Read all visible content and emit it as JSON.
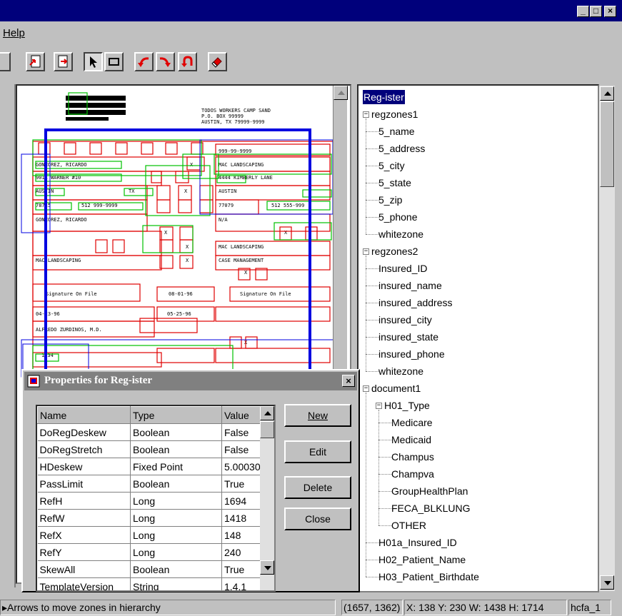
{
  "window": {
    "caption_buttons": [
      "_",
      "□",
      "×"
    ]
  },
  "menubar": {
    "items": [
      {
        "label": "Help"
      }
    ]
  },
  "toolbar": {
    "buttons": [
      "import-icon",
      "export-icon",
      "select-pointer-icon",
      "zone-rectangle-icon",
      "rotate-left-icon",
      "rotate-right-icon",
      "undo-icon",
      "eraser-icon"
    ]
  },
  "document": {
    "header_lines": [
      "TODOS WORKERS CAMP SAND",
      "P.O. BOX 99999",
      "AUSTIN, TX  79999-9999"
    ],
    "fields": [
      "999-99-9999",
      "GONZOREZ, RICARDO",
      "MAC LANDSCAPING",
      "9011 WARNER #10",
      "X",
      "4444 KIMBERLY LANE",
      "AUSTIN",
      "TX",
      "X",
      "AUSTIN",
      "78715",
      "512 999-9999",
      "77079",
      "512 555-999",
      "GONZOREZ, RICARDO",
      "N/A",
      "X",
      "X",
      "X",
      "MAC LANDSCAPING",
      "MAC LANDSCAPING",
      "X",
      "CASE MANAGEMENT",
      "X",
      "Signature On File",
      "08-01-96",
      "Signature On File",
      "04-23-96",
      "05-25-96",
      "ALFREDO ZURDINOS, M.D.",
      "X",
      "1234"
    ]
  },
  "tree": {
    "nodes": [
      {
        "label": "Reg-ister",
        "depth": 0,
        "expander": "",
        "selected": true
      },
      {
        "label": "regzones1",
        "depth": 0,
        "expander": "−"
      },
      {
        "label": "5_name",
        "depth": 1,
        "expander": ""
      },
      {
        "label": "5_address",
        "depth": 1,
        "expander": ""
      },
      {
        "label": "5_city",
        "depth": 1,
        "expander": ""
      },
      {
        "label": "5_state",
        "depth": 1,
        "expander": ""
      },
      {
        "label": "5_zip",
        "depth": 1,
        "expander": ""
      },
      {
        "label": "5_phone",
        "depth": 1,
        "expander": ""
      },
      {
        "label": "whitezone",
        "depth": 1,
        "expander": ""
      },
      {
        "label": "regzones2",
        "depth": 0,
        "expander": "−"
      },
      {
        "label": "Insured_ID",
        "depth": 1,
        "expander": ""
      },
      {
        "label": "insured_name",
        "depth": 1,
        "expander": ""
      },
      {
        "label": "insured_address",
        "depth": 1,
        "expander": ""
      },
      {
        "label": "insured_city",
        "depth": 1,
        "expander": ""
      },
      {
        "label": "insured_state",
        "depth": 1,
        "expander": ""
      },
      {
        "label": "insured_phone",
        "depth": 1,
        "expander": ""
      },
      {
        "label": "whitezone",
        "depth": 1,
        "expander": ""
      },
      {
        "label": "document1",
        "depth": 0,
        "expander": "−"
      },
      {
        "label": "H01_Type",
        "depth": 1,
        "expander": "−"
      },
      {
        "label": "Medicare",
        "depth": 2,
        "expander": ""
      },
      {
        "label": "Medicaid",
        "depth": 2,
        "expander": ""
      },
      {
        "label": "Champus",
        "depth": 2,
        "expander": ""
      },
      {
        "label": "Champva",
        "depth": 2,
        "expander": ""
      },
      {
        "label": "GroupHealthPlan",
        "depth": 2,
        "expander": ""
      },
      {
        "label": "FECA_BLKLUNG",
        "depth": 2,
        "expander": ""
      },
      {
        "label": "OTHER",
        "depth": 2,
        "expander": ""
      },
      {
        "label": "H01a_Insured_ID",
        "depth": 1,
        "expander": ""
      },
      {
        "label": "H02_Patient_Name",
        "depth": 1,
        "expander": ""
      },
      {
        "label": "H03_Patient_Birthdate",
        "depth": 1,
        "expander": ""
      }
    ]
  },
  "dialog": {
    "title": "Properties for Reg-ister",
    "close_label": "×",
    "columns": [
      "Name",
      "Type",
      "Value"
    ],
    "rows": [
      [
        "DoRegDeskew",
        "Boolean",
        "False"
      ],
      [
        "DoRegStretch",
        "Boolean",
        "False"
      ],
      [
        "HDeskew",
        "Fixed Point",
        "5.00030"
      ],
      [
        "PassLimit",
        "Boolean",
        "True"
      ],
      [
        "RefH",
        "Long",
        "1694"
      ],
      [
        "RefW",
        "Long",
        "1418"
      ],
      [
        "RefX",
        "Long",
        "148"
      ],
      [
        "RefY",
        "Long",
        "240"
      ],
      [
        "SkewAll",
        "Boolean",
        "True"
      ],
      [
        "TemplateVersion",
        "String",
        "1.4.1"
      ]
    ],
    "buttons": {
      "new": "New",
      "edit": "Edit",
      "delete": "Delete",
      "close": "Close"
    }
  },
  "statusbar": {
    "hint": "Arrows to move zones in hierarchy",
    "cursor": "(1657, 1362)",
    "coords": "X: 138  Y: 230  W: 1438  H: 1714",
    "template": "hcfa_1"
  },
  "colors": {
    "title_active": "#00007b",
    "title_inactive": "#808080",
    "zone_red": "#e00000",
    "zone_green": "#00c000",
    "zone_blue": "#0000e0",
    "face": "#c0c0c0"
  }
}
